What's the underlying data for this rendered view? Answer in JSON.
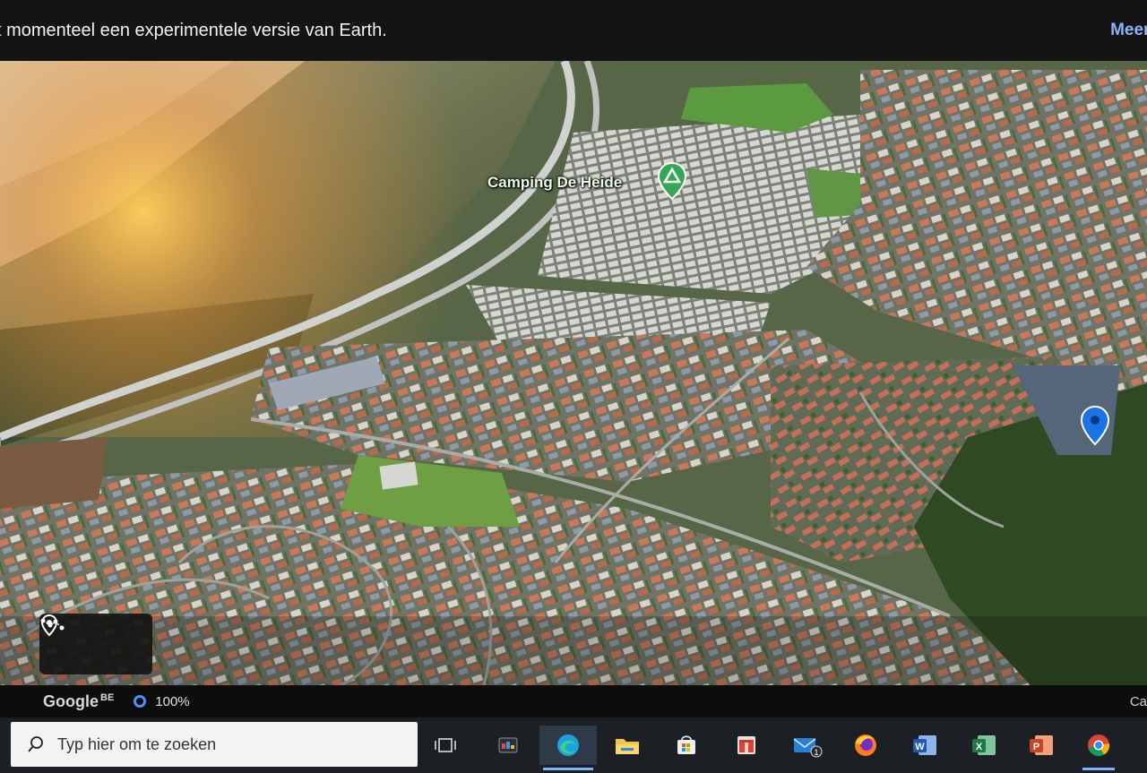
{
  "banner": {
    "text": "t momenteel een experimentele versie van Earth.",
    "link_label": "Meer i"
  },
  "map": {
    "place_label": "Camping De Heide",
    "place_marker_icon": "campground-marker-icon",
    "location_pin_icon": "location-pin-icon",
    "tools": [
      "place-marker-icon",
      "path-measure-icon"
    ]
  },
  "status_bar": {
    "brand": "Google",
    "region": "BE",
    "load_percent": "100%",
    "right_label": "Ca"
  },
  "taskbar": {
    "search_placeholder": "Typ hier om te zoeken",
    "apps": [
      "task-view-icon",
      "start-app-icon",
      "edge-icon",
      "file-explorer-icon",
      "store-icon",
      "gift-icon",
      "mail-icon",
      "firefox-icon",
      "word-icon",
      "excel-icon",
      "powerpoint-icon",
      "chrome-icon"
    ],
    "word_letter": "W",
    "excel_letter": "X",
    "powerpoint_letter": "P",
    "mail_badge": "1"
  },
  "colors": {
    "banner_link": "#8ab4f8",
    "poi_green": "#34a853",
    "pin_blue": "#1a73e8",
    "taskbar_bg": "#1c1f24"
  }
}
